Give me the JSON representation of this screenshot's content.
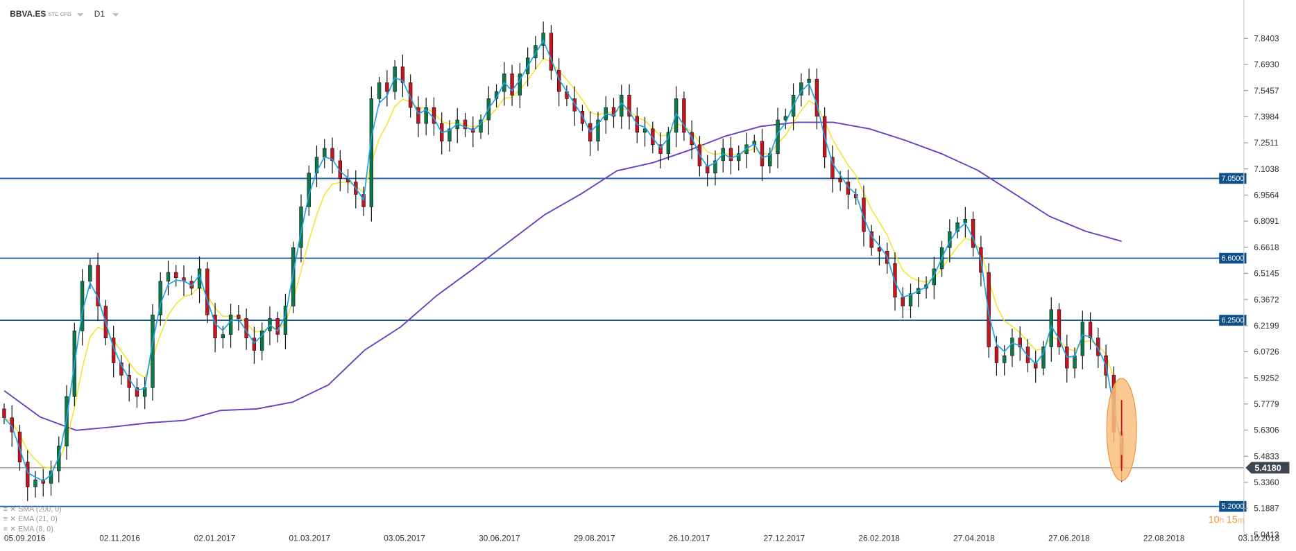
{
  "header": {
    "symbol": "BBVA.ES",
    "instrument_type": "STC CFD",
    "timeframe": "D1"
  },
  "legend": [
    {
      "label": "SMA (200, 0)",
      "color": "#6a3fc0"
    },
    {
      "label": "EMA (21, 0)",
      "color": "#f5e43a"
    },
    {
      "label": "EMA (8, 0)",
      "color": "#1aa3e8"
    }
  ],
  "countdown": {
    "hours": "10",
    "h": "h",
    "minutes": "15",
    "m": "m",
    "color": "#f0923a"
  },
  "chart_data": {
    "type": "candlestick",
    "title": "",
    "ylim": [
      5.0413,
      7.9
    ],
    "grid": false,
    "y_ticks": [
      "7.8403",
      "7.6930",
      "7.5457",
      "7.3984",
      "7.2511",
      "7.1038",
      "6.9564",
      "6.8091",
      "6.6618",
      "6.5145",
      "6.3672",
      "6.2199",
      "6.0726",
      "5.9252",
      "5.7779",
      "5.6306",
      "5.4833",
      "5.3360",
      "5.1887",
      "5.0413"
    ],
    "x_ticks": [
      "05.09.2016",
      "02.11.2016",
      "02.01.2017",
      "01.03.2017",
      "03.05.2017",
      "30.06.2017",
      "29.08.2017",
      "26.10.2017",
      "27.12.2017",
      "26.02.2018",
      "27.04.2018",
      "27.06.2018",
      "22.08.2018",
      "03.10.2018"
    ],
    "closes": [
      5.7,
      5.62,
      5.45,
      5.31,
      5.35,
      5.33,
      5.4,
      5.54,
      5.82,
      6.19,
      6.47,
      6.56,
      6.33,
      6.15,
      6.01,
      5.94,
      5.87,
      5.82,
      5.87,
      6.28,
      6.47,
      6.52,
      6.49,
      6.47,
      6.43,
      6.54,
      6.28,
      6.15,
      6.17,
      6.28,
      6.26,
      6.15,
      6.08,
      6.19,
      6.26,
      6.17,
      6.33,
      6.66,
      6.89,
      7.08,
      7.17,
      7.22,
      7.15,
      7.05,
      7.03,
      6.96,
      6.89,
      7.5,
      7.59,
      7.54,
      7.68,
      7.59,
      7.45,
      7.36,
      7.45,
      7.36,
      7.26,
      7.33,
      7.38,
      7.33,
      7.31,
      7.38,
      7.5,
      7.54,
      7.64,
      7.52,
      7.64,
      7.73,
      7.8,
      7.87,
      7.66,
      7.54,
      7.5,
      7.43,
      7.36,
      7.26,
      7.38,
      7.45,
      7.4,
      7.52,
      7.4,
      7.31,
      7.33,
      7.24,
      7.19,
      7.31,
      7.5,
      7.31,
      7.24,
      7.12,
      7.08,
      7.15,
      7.22,
      7.15,
      7.19,
      7.24,
      7.26,
      7.12,
      7.19,
      7.38,
      7.4,
      7.52,
      7.59,
      7.61,
      7.4,
      7.17,
      7.05,
      7.03,
      6.96,
      6.94,
      6.75,
      6.66,
      6.64,
      6.57,
      6.38,
      6.33,
      6.4,
      6.43,
      6.45,
      6.54,
      6.66,
      6.75,
      6.8,
      6.82,
      6.66,
      6.52,
      6.1,
      6.01,
      6.05,
      6.15,
      6.1,
      6.01,
      5.98,
      6.1,
      6.31,
      6.1,
      5.98,
      6.05,
      6.24,
      6.15,
      6.05,
      5.94,
      5.62,
      5.418
    ],
    "sma200": [
      5.853,
      5.704,
      5.629,
      5.648,
      5.671,
      5.685,
      5.741,
      5.75,
      5.788,
      5.886,
      6.081,
      6.212,
      6.389,
      6.538,
      6.692,
      6.846,
      6.962,
      7.093,
      7.139,
      7.209,
      7.288,
      7.344,
      7.367,
      7.367,
      7.33,
      7.265,
      7.19,
      7.097,
      6.967,
      6.836,
      6.752,
      6.696
    ],
    "levels": [
      {
        "label": "7.0500",
        "value": 7.05
      },
      {
        "label": "6.6000",
        "value": 6.6
      },
      {
        "label": "6.2500",
        "value": 6.25
      },
      {
        "label": "5.2000",
        "value": 5.2
      }
    ],
    "current_price": {
      "label": "5.4180",
      "value": 5.418
    },
    "colors": {
      "up": "#0b7a4b",
      "down": "#c8141e",
      "level": "#1d5d9b",
      "level_label": "#0e4f8a",
      "current": "#3b4650",
      "sma": "#6a3fc0",
      "ema21": "#f5e43a",
      "ema8": "#1aa3e8",
      "highlight": "#f9c07f"
    }
  }
}
